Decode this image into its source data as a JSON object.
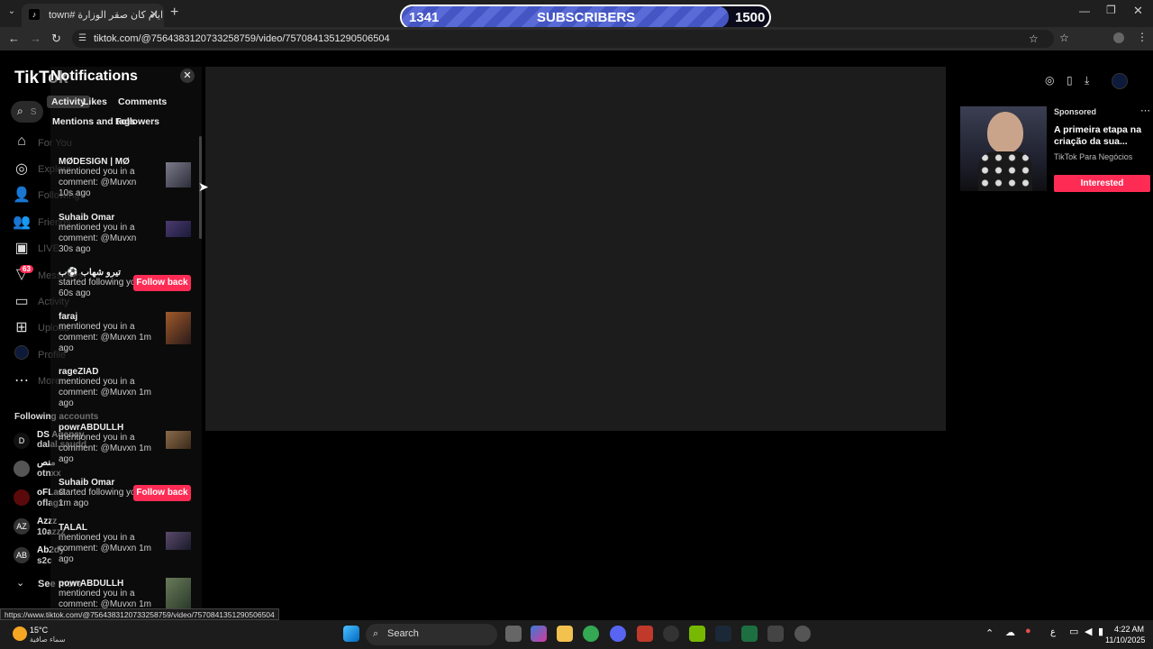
{
  "browser": {
    "tab_title": "town# ايام كان صقر الوزارة",
    "new_tab": "+",
    "url": "tiktok.com/@7564383120733258759/video/7570841351290506504",
    "status_url": "https://www.tiktok.com/@7564383120733258759/video/7570841351290506504"
  },
  "subscribers": {
    "current": "1341",
    "label": "SUBSCRIBERS",
    "goal": "1500",
    "progress_fraction": 0.89
  },
  "nav": {
    "logo": "TikTok",
    "search_placeholder": "S",
    "items": [
      {
        "label": "For You",
        "icon": "home-icon"
      },
      {
        "label": "Explore",
        "icon": "compass-icon"
      },
      {
        "label": "Following",
        "icon": "following-icon"
      },
      {
        "label": "Friends",
        "icon": "friends-icon"
      },
      {
        "label": "LIVE",
        "icon": "live-icon"
      },
      {
        "label": "Messages",
        "icon": "messages-icon",
        "badge": "63"
      },
      {
        "label": "Activity",
        "icon": "activity-icon"
      },
      {
        "label": "Upload",
        "icon": "upload-icon"
      },
      {
        "label": "Profile",
        "icon": "profile-icon"
      },
      {
        "label": "More",
        "icon": "more-icon"
      }
    ],
    "following_header": "Following accounts",
    "following": [
      {
        "name": "DS Agency",
        "handle": "dalal.saudd",
        "avatar": "D"
      },
      {
        "name": "منص",
        "handle": "otnxx",
        "avatar": ""
      },
      {
        "name": "oFLaG",
        "handle": "oflagx",
        "avatar": ""
      },
      {
        "name": "Azzz",
        "handle": "10azzz",
        "avatar": "AZ"
      },
      {
        "name": "Ab2dy",
        "handle": "s2c",
        "avatar": "AB"
      }
    ],
    "see_more": "See more"
  },
  "notifications": {
    "title": "Notifications",
    "tabs": [
      "Activity",
      "Likes",
      "Comments",
      "Mentions and tags",
      "Followers"
    ],
    "items": [
      {
        "name": "MØDESIGN | MØ",
        "text": "mentioned you in a comment: @Muvxn",
        "time": "10s ago",
        "action": "thumb"
      },
      {
        "name": "Suhaib Omar",
        "text": "mentioned you in a comment: @Muvxn",
        "time": "30s ago",
        "action": "thumb"
      },
      {
        "name": "تيرو شهاب ⚽️ب",
        "text": "started following you.",
        "time": "60s ago",
        "action": "follow"
      },
      {
        "name": "faraj",
        "text": "mentioned you in a comment: @Muvxn",
        "time": "1m ago",
        "action": "thumb"
      },
      {
        "name": "rageZIAD",
        "text": "mentioned you in a comment: @Muvxn",
        "time": "1m ago",
        "action": "none"
      },
      {
        "name": "powrABDULLH",
        "text": "mentioned you in a comment: @Muvxn",
        "time": "1m ago",
        "action": "thumb"
      },
      {
        "name": "Suhaib Omar",
        "text": "started following you.",
        "time": "1m ago",
        "action": "follow"
      },
      {
        "name": "TALAL",
        "text": "mentioned you in a comment: @Muvxn",
        "time": "1m ago",
        "action": "thumb"
      },
      {
        "name": "powrABDULLH",
        "text": "mentioned you in a comment: @Muvxn",
        "time": "1m",
        "action": "thumb"
      }
    ],
    "follow_back": "Follow back"
  },
  "ad": {
    "sponsored": "Sponsored",
    "title": "A primeira etapa na criação da sua...",
    "advertiser": "TikTok Para Negócios",
    "cta": "Interested"
  },
  "taskbar": {
    "weather_temp": "15°C",
    "weather_desc": "سماء صافية",
    "search": "Search",
    "time": "4:22 AM",
    "date": "11/10/2025",
    "lang": "ع"
  },
  "colors": {
    "accent": "#fe2c55",
    "progress": "#4556c4"
  }
}
